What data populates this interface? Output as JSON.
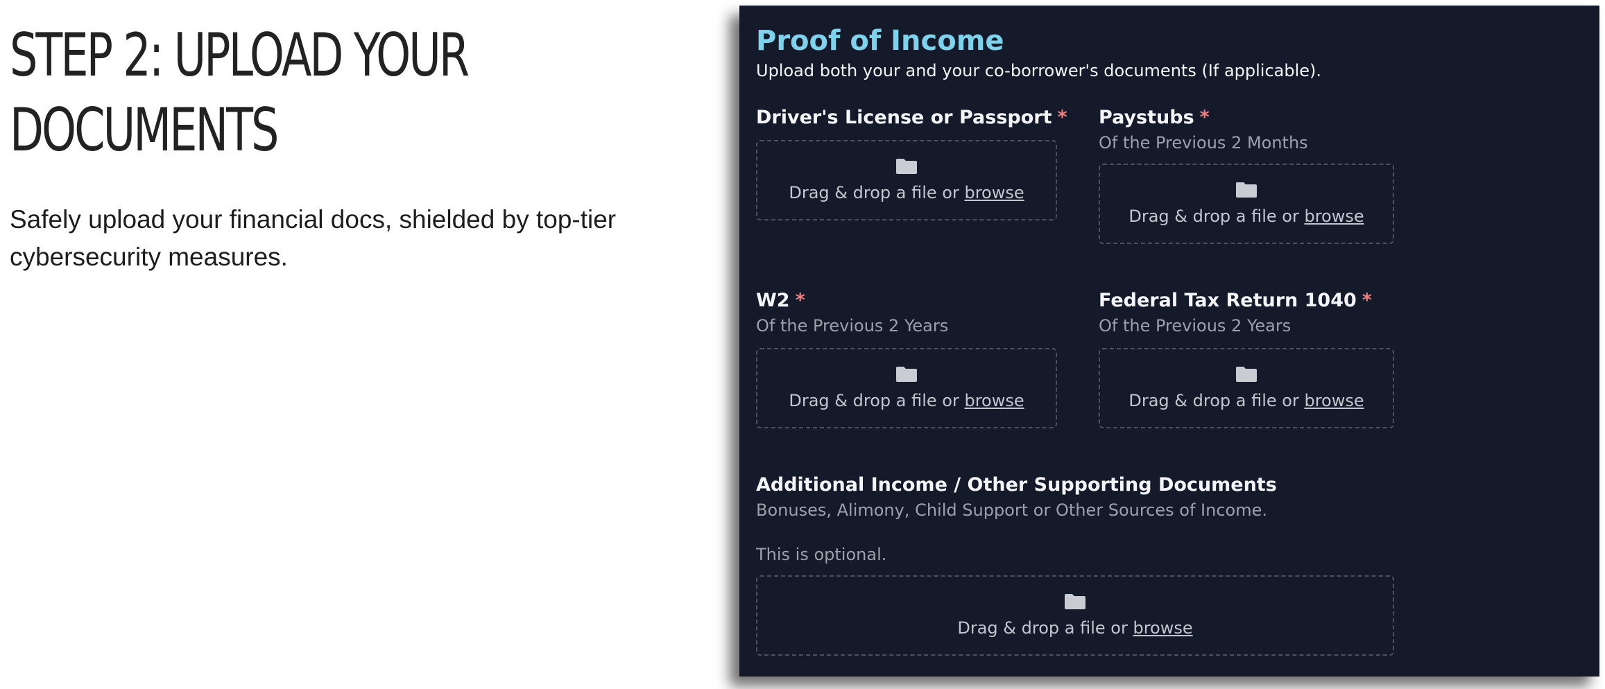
{
  "hero": {
    "title_line1": "STEP 2: UPLOAD YOUR",
    "title_line2": "DOCUMENTS",
    "description_line1": "Safely upload your financial docs, shielded by top-tier",
    "description_line2": "cybersecurity measures."
  },
  "card": {
    "title": "Proof of Income",
    "subtitle": "Upload both your and your co-borrower's documents (If applicable).",
    "dropzone_text": "Drag & drop a file or ",
    "browse_label": "browse",
    "required_mark": "*",
    "folder_icon": "folder-icon",
    "fields": {
      "license": {
        "label": "Driver's License or Passport"
      },
      "paystubs": {
        "label": "Paystubs",
        "hint": "Of the Previous 2 Months"
      },
      "w2": {
        "label": "W2",
        "hint": "Of the Previous 2 Years"
      },
      "tax": {
        "label": "Federal Tax Return 1040",
        "hint": "Of the Previous 2 Years"
      },
      "additional": {
        "label": "Additional Income / Other Supporting Documents",
        "hint": "Bonuses, Alimony, Child Support or Other Sources of Income.",
        "note": "This is optional."
      }
    }
  },
  "colors": {
    "card_background": "#141a29",
    "title_accent": "#7ed2ec",
    "required_asterisk": "#f07f7f"
  }
}
